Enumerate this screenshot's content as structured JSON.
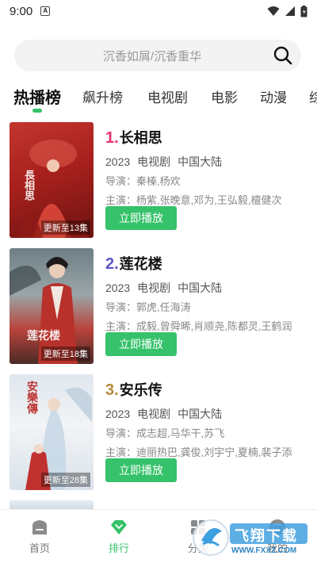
{
  "status_bar": {
    "time": "9:00",
    "notification_icon": "A"
  },
  "search": {
    "placeholder": "沉香如屑/沉香重华"
  },
  "tabs": [
    {
      "label": "热播榜",
      "active": true
    },
    {
      "label": "飙升榜",
      "active": false
    },
    {
      "label": "电视剧",
      "active": false
    },
    {
      "label": "电影",
      "active": false
    },
    {
      "label": "动漫",
      "active": false
    },
    {
      "label": "综",
      "active": false
    }
  ],
  "items": [
    {
      "rank": "1.",
      "rank_color": "#e8336d",
      "title": "长相思",
      "year": "2023",
      "type": "电视剧",
      "region": "中国大陆",
      "director": "导演：秦榛,杨欢",
      "cast": "主演：杨紫,张晚意,邓为,王弘毅,檀健次",
      "update": "更新至13集",
      "play_label": "立即播放",
      "poster_text": "長相思"
    },
    {
      "rank": "2.",
      "rank_color": "#5a55c8",
      "title": "莲花楼",
      "year": "2023",
      "type": "电视剧",
      "region": "中国大陆",
      "director": "导演：郭虎,任海涛",
      "cast": "主演：成毅,曾舜晞,肖顺尧,陈都灵,王鹤润",
      "update": "更新至18集",
      "play_label": "立即播放",
      "poster_text": "莲花楼"
    },
    {
      "rank": "3.",
      "rank_color": "#b58a3c",
      "title": "安乐传",
      "year": "2023",
      "type": "电视剧",
      "region": "中国大陆",
      "director": "导演：成志超,马华干,苏飞",
      "cast": "主演：迪丽热巴,龚俊,刘宇宁,夏楠,裴子添",
      "update": "更新至28集",
      "play_label": "立即播放",
      "poster_text": "安樂傳"
    }
  ],
  "bottom_nav": [
    {
      "label": "首页",
      "icon": "home-icon",
      "active": false
    },
    {
      "label": "排行",
      "icon": "diamond-icon",
      "active": true
    },
    {
      "label": "分类",
      "icon": "category-icon",
      "active": false
    },
    {
      "label": "我的",
      "icon": "profile-icon",
      "active": false
    }
  ],
  "watermark": {
    "brand": "飞翔下载",
    "url": "WWW.FXXZ.COM"
  },
  "colors": {
    "accent": "#35c26a"
  }
}
